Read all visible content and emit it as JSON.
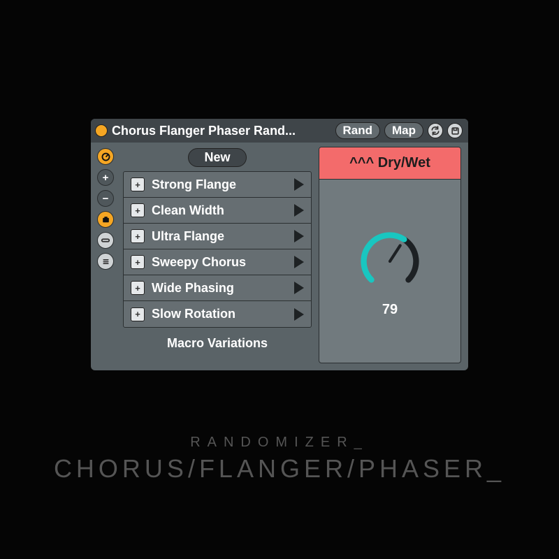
{
  "titlebar": {
    "title": "Chorus Flanger Phaser Rand...",
    "rand": "Rand",
    "map": "Map"
  },
  "toolbar": {
    "new_label": "New"
  },
  "variations": [
    {
      "label": "Strong Flange"
    },
    {
      "label": "Clean Width"
    },
    {
      "label": "Ultra Flange"
    },
    {
      "label": "Sweepy Chorus"
    },
    {
      "label": "Wide Phasing"
    },
    {
      "label": "Slow Rotation"
    }
  ],
  "variations_footer": "Macro Variations",
  "macro": {
    "name": "^^^ Dry/Wet",
    "value": 79,
    "header_color": "#f36b6b"
  },
  "caption": {
    "small": "RANDOMIZER_",
    "large": "CHORUS/FLANGER/PHASER_"
  },
  "chart_data": {
    "type": "pie",
    "title": "^^^ Dry/Wet",
    "values": [
      79
    ],
    "categories": [
      "Dry/Wet"
    ],
    "ylim": [
      0,
      127
    ]
  }
}
